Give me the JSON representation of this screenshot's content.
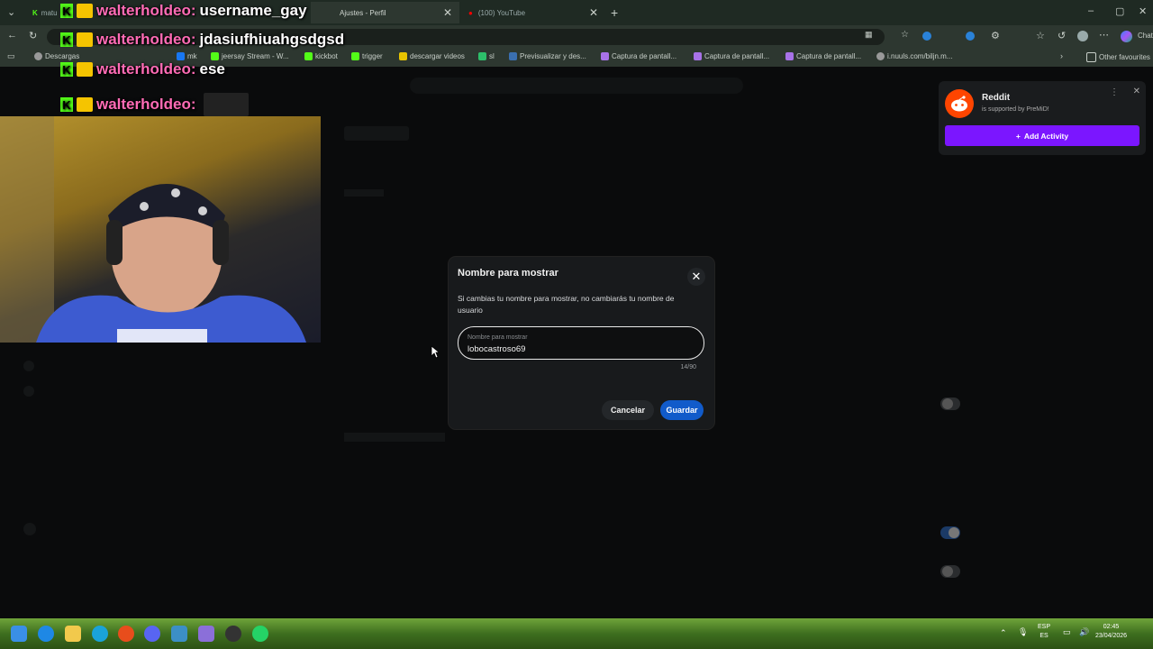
{
  "browser": {
    "tabs": [
      {
        "label": "matu"
      },
      {
        "label": "Ajustes - Perfil"
      },
      {
        "label": "(100) YouTube"
      }
    ],
    "bookmarks": [
      "Descargas",
      "mk",
      "jeersay Stream - W...",
      "kickbot",
      "trigger",
      "descargar videos",
      "sl",
      "Previsualizar y des...",
      "Captura de pantall...",
      "Captura de pantall...",
      "Captura de pantall...",
      "i.nuuls.com/biljn.m..."
    ],
    "other_favourites": "Other favourites",
    "chat_label": "Chat"
  },
  "modal": {
    "title": "Nombre para mostrar",
    "description": "Si cambias tu nombre para mostrar, no cambiarás tu nombre de usuario",
    "field_label": "Nombre para mostrar",
    "field_value": "lobocastroso69",
    "counter": "14/90",
    "cancel": "Cancelar",
    "save": "Guardar"
  },
  "premid": {
    "title": "Reddit",
    "subtitle": "is supported by PreMiD!",
    "button": "Add Activity"
  },
  "stream_chat": [
    {
      "user": "walterholdeo:",
      "message": "username_gay"
    },
    {
      "user": "walterholdeo:",
      "message": "jdasiufhiuahgsdgsd"
    },
    {
      "user": "walterholdeo:",
      "message": "ese"
    },
    {
      "user": "walterholdeo:",
      "message": ""
    }
  ],
  "taskbar": {
    "lang_top": "ESP",
    "lang_bottom": "ES",
    "time": "02:45",
    "date": "23/04/2026"
  },
  "colors": {
    "save_button": "#115bca",
    "premid_button": "#7b16ff",
    "reddit_orange": "#ff4500",
    "chat_username": "#ff6bb5"
  }
}
